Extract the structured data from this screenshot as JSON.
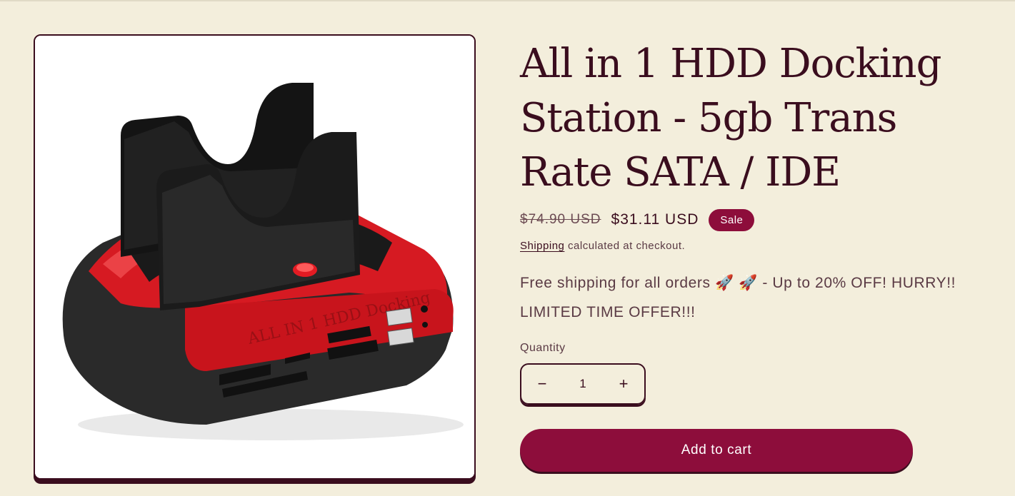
{
  "product": {
    "title": "All in 1 HDD Docking Station - 5gb Trans Rate SATA / IDE",
    "price_regular": "$74.90 USD",
    "price_sale": "$31.11 USD",
    "sale_badge": "Sale",
    "shipping_link": "Shipping",
    "shipping_text": " calculated at checkout.",
    "promo_text": "Free shipping for all orders 🚀 🚀 - Up to 20% OFF! HURRY!! LIMITED TIME OFFER!!!",
    "image_text": "ALL IN 1 HDD Docking"
  },
  "quantity": {
    "label": "Quantity",
    "minus": "−",
    "value": "1",
    "plus": "+"
  },
  "cart": {
    "add_label": "Add to cart"
  },
  "colors": {
    "background": "#f3eedc",
    "text": "#3a0d1e",
    "accent": "#8d0d3b"
  },
  "icons": {
    "minus": "minus-icon",
    "plus": "plus-icon",
    "rocket": "rocket-icon"
  }
}
